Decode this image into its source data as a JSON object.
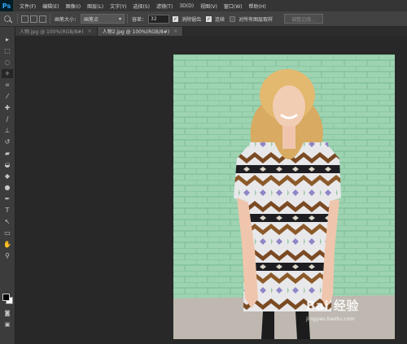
{
  "app": {
    "logo": "Ps"
  },
  "menu": [
    "文件(F)",
    "编辑(E)",
    "图像(I)",
    "图层(L)",
    "文字(Y)",
    "选择(S)",
    "滤镜(T)",
    "3D(D)",
    "视图(V)",
    "窗口(W)",
    "帮助(H)"
  ],
  "options": {
    "brush_size_label": "画笔大小：",
    "brush_size_value": "画笔点",
    "tolerance_label": "容差：",
    "tolerance_value": "32",
    "antialias_label": "消除锯齿",
    "contiguous_label": "连续",
    "sample_all_label": "对所有图层取样",
    "refine_edge_label": "调整边缘..."
  },
  "tabs": [
    {
      "label": "人物.jpg @ 100%(RGB/8#)",
      "close": "×"
    },
    {
      "label": "人物2.jpg @ 100%(RGB/8#)",
      "close": "×"
    }
  ],
  "tools": [
    {
      "icon": "move-icon",
      "glyph": "▸"
    },
    {
      "icon": "marquee-icon",
      "glyph": "⬚"
    },
    {
      "icon": "lasso-icon",
      "glyph": "◌"
    },
    {
      "icon": "magic-wand-icon",
      "glyph": "✧"
    },
    {
      "icon": "crop-icon",
      "glyph": "⌗"
    },
    {
      "icon": "eyedropper-icon",
      "glyph": "⁄"
    },
    {
      "icon": "healing-brush-icon",
      "glyph": "✚"
    },
    {
      "icon": "brush-icon",
      "glyph": "∕"
    },
    {
      "icon": "clone-stamp-icon",
      "glyph": "⊥"
    },
    {
      "icon": "history-brush-icon",
      "glyph": "↺"
    },
    {
      "icon": "eraser-icon",
      "glyph": "▰"
    },
    {
      "icon": "paint-bucket-icon",
      "glyph": "◒"
    },
    {
      "icon": "blur-icon",
      "glyph": "◆"
    },
    {
      "icon": "dodge-icon",
      "glyph": "●"
    },
    {
      "icon": "pen-icon",
      "glyph": "✒"
    },
    {
      "icon": "type-icon",
      "glyph": "T"
    },
    {
      "icon": "path-selection-icon",
      "glyph": "↖"
    },
    {
      "icon": "shape-icon",
      "glyph": "▭"
    },
    {
      "icon": "hand-icon",
      "glyph": "✋"
    },
    {
      "icon": "zoom-icon",
      "glyph": "⚲"
    }
  ],
  "watermark": {
    "logo": "Bai 经验",
    "url": "jingyan.baidu.com"
  },
  "colors": {
    "wall": "#9ed3b2",
    "brick_line": "#7fbf9a",
    "menubar": "#353535",
    "options_bar": "#424242",
    "canvas_bg": "#282828"
  }
}
